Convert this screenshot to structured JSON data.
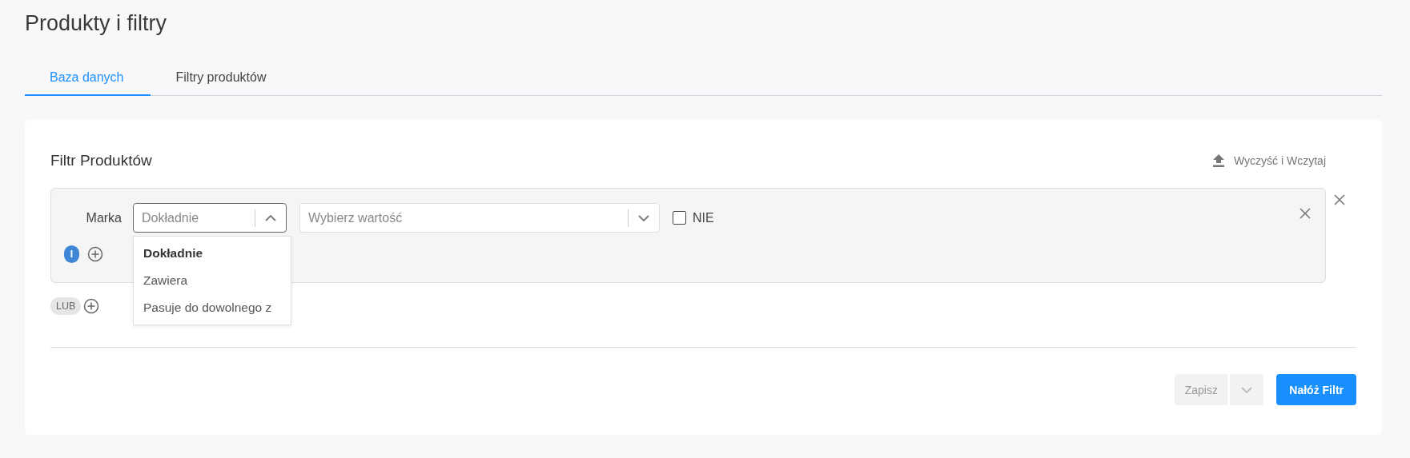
{
  "page": {
    "title": "Produkty i filtry"
  },
  "tabs": [
    {
      "label": "Baza danych",
      "selected": true
    },
    {
      "label": "Filtry produktów",
      "selected": false
    }
  ],
  "filter": {
    "title": "Filtr Produktów",
    "load_action": "Wyczyść i Wczytaj",
    "group": {
      "conditions": [
        {
          "field": "Marka",
          "operator": {
            "placeholder": "Dokładnie",
            "expanded": true,
            "options": [
              {
                "label": "Dokładnie",
                "selected": true
              },
              {
                "label": "Zawiera",
                "selected": false
              },
              {
                "label": "Pasuje do dowolnego z",
                "selected": false
              }
            ]
          },
          "value": {
            "placeholder": "Wybierz wartość"
          },
          "negate": {
            "label": "NIE",
            "checked": false
          }
        }
      ],
      "and_label": "I"
    },
    "or_label": "LUB"
  },
  "actions": {
    "save": {
      "label": "Zapisz",
      "disabled": true
    },
    "apply": {
      "label": "Nałóż Filtr"
    }
  }
}
